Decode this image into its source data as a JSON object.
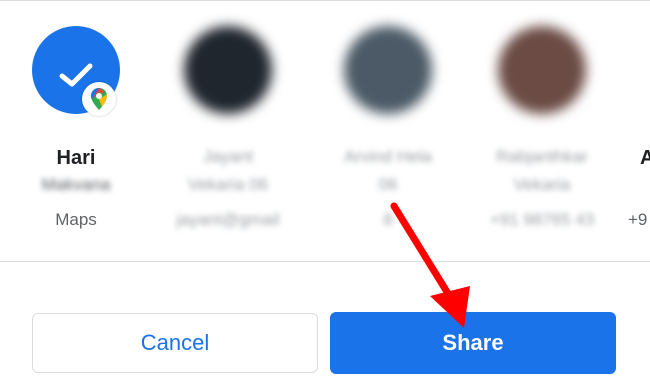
{
  "contacts": [
    {
      "name": "Hari",
      "sub": "Makvana",
      "app": "Maps"
    },
    {
      "name": "Jayant",
      "name2": "Vekaria 06",
      "sub": "jayant@gmail",
      "blurred": true
    },
    {
      "name": "Arvind Hela",
      "name2": "06",
      "sub": "8",
      "blurred": true
    },
    {
      "name": "Rabjanthkar",
      "name2": "Vekaria",
      "sub": "+91 98765 43",
      "blurred": true
    },
    {
      "name": "A",
      "sub": "+9"
    }
  ],
  "buttons": {
    "cancel": "Cancel",
    "share": "Share"
  },
  "colors": {
    "accent": "#1a73e8",
    "annotation_arrow": "#ff0000"
  }
}
